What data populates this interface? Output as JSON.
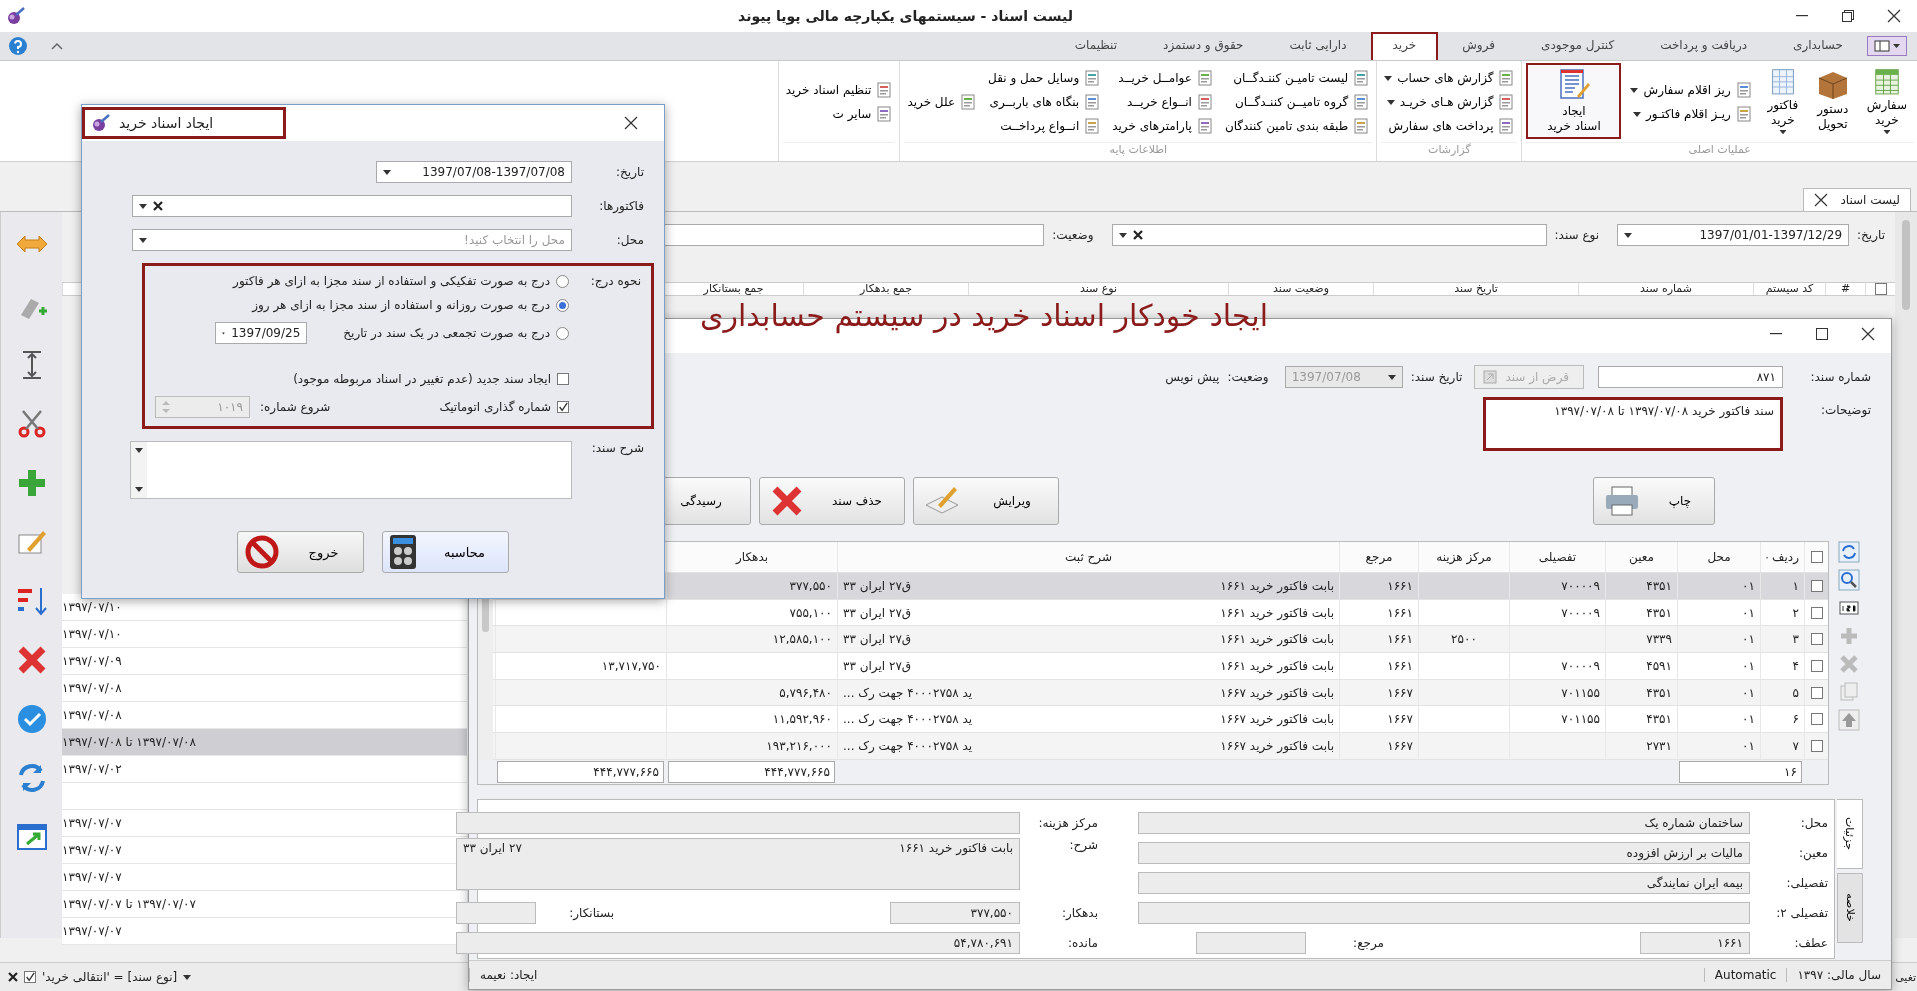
{
  "window": {
    "title": "لیست اسناد - سیستمهای یکپارچه مالی پویا پیوند"
  },
  "menu_tabs": [
    {
      "label": "حسابداری",
      "selected": false
    },
    {
      "label": "دریافت و پرداخت",
      "selected": false
    },
    {
      "label": "کنترل موجودی",
      "selected": false
    },
    {
      "label": "فروش",
      "selected": false
    },
    {
      "label": "خرید",
      "selected": true
    },
    {
      "label": "دارایی ثابت",
      "selected": false
    },
    {
      "label": "حقوق و دستمزد",
      "selected": false
    },
    {
      "label": "تنظیمات",
      "selected": false
    }
  ],
  "ribbon": [
    {
      "label": "عملیات اصلی",
      "items": [
        {
          "kind": "large",
          "lines": [
            "سفارش",
            "خرید"
          ],
          "dropdown": true,
          "highlighted": false
        },
        {
          "kind": "large",
          "lines": [
            "دستور",
            "تحویل"
          ],
          "dropdown": false,
          "highlighted": false
        },
        {
          "kind": "large",
          "lines": [
            "فاکتور",
            "خرید"
          ],
          "dropdown": true,
          "highlighted": false
        },
        {
          "kind": "small",
          "label": "ریز اقلام سفارش",
          "dropdown": true
        },
        {
          "kind": "small",
          "label": "ریـز اقلام فاکتـور",
          "dropdown": true
        },
        {
          "kind": "large",
          "lines": [
            "ایجاد",
            "اسناد خرید"
          ],
          "dropdown": false,
          "highlighted": true
        }
      ]
    },
    {
      "label": "گزارشات",
      "items": [
        {
          "kind": "small",
          "label": "گزارش های حساب",
          "dropdown": true
        },
        {
          "kind": "small",
          "label": "گزارش هـای خریـد",
          "dropdown": true
        },
        {
          "kind": "small",
          "label": "پرداخت های سفارش",
          "dropdown": false
        }
      ]
    },
    {
      "label": "اطلاعات پایه",
      "items": [
        {
          "kind": "small",
          "label": "لیست تامیـن کننـدگــان",
          "dropdown": false
        },
        {
          "kind": "small",
          "label": "گروه تامیــن کننـدگــان",
          "dropdown": false
        },
        {
          "kind": "small",
          "label": "طبقه بندی تامین کنندگان",
          "dropdown": false
        },
        {
          "kind": "small",
          "label": "عوامــل خریــد",
          "dropdown": false
        },
        {
          "kind": "small",
          "label": "انــواع خریــد",
          "dropdown": false
        },
        {
          "kind": "small",
          "label": "پارامترهای خرید",
          "dropdown": false
        },
        {
          "kind": "small",
          "label": "وسایل حمل و نقل",
          "dropdown": false
        },
        {
          "kind": "small",
          "label": "بنگاه های باربــری",
          "dropdown": false
        },
        {
          "kind": "small",
          "label": "انــواع پرداخــت",
          "dropdown": false
        },
        {
          "kind": "small",
          "label": "علل خرید",
          "dropdown": false
        }
      ]
    },
    {
      "items": [
        {
          "kind": "small",
          "label": "تنظیم اسناد خرید",
          "dropdown": false
        },
        {
          "kind": "small",
          "label": "سایر ت",
          "dropdown": false
        }
      ]
    }
  ],
  "doc_tab": {
    "label": "لیست اسناد"
  },
  "filters": [
    {
      "label": "تاریخ:",
      "value": "1397/01/01-1397/12/29"
    },
    {
      "label": "نوع سند:"
    },
    {
      "label": "وضعیت:"
    }
  ],
  "grid_select_all": {
    "checked": false
  },
  "grid_columns": [
    "#",
    "کد سیستم",
    "شماره سند",
    "تاریخ سند",
    "وضعیت سند",
    "نوع سند",
    "جمع بدهکار",
    "جمع بستانکار"
  ],
  "doc_list": [
    {
      "text": "۱۳۹۷/۰۷/۱۰",
      "selected": false
    },
    {
      "text": "۱۳۹۷/۰۷/۱۰",
      "selected": false
    },
    {
      "text": "۱۳۹۷/۰۷/۰۹",
      "selected": false
    },
    {
      "text": "۱۳۹۷/۰۷/۰۸",
      "selected": false
    },
    {
      "text": "۱۳۹۷/۰۷/۰۸",
      "selected": false
    },
    {
      "text": "۱۳۹۷/۰۷/۰۸ تا ۱۳۹۷/۰۷/۰۸",
      "selected": true
    },
    {
      "text": "۱۳۹۷/۰۷/۰۲",
      "selected": false
    },
    {
      "selected": false
    },
    {
      "text": "۱۳۹۷/۰۷/۰۷",
      "selected": false
    },
    {
      "text": "۱۳۹۷/۰۷/۰۷",
      "selected": false
    },
    {
      "text": "۱۳۹۷/۰۷/۰۷",
      "selected": false
    },
    {
      "text": "۱۳۹۷/۰۷/۰۷ تا ۱۳۹۷/۰۷/۰۷",
      "selected": false
    },
    {
      "text": "۱۳۹۷/۰۷/۰۷",
      "selected": false
    }
  ],
  "filter_bar": {
    "checked": true,
    "text": "[نوع سند] = 'انتقالی خرید'"
  },
  "status_bar": {
    "text": "تغیی"
  },
  "dialog": {
    "title": "ایجاد اسناد خرید",
    "title_highlighted": true,
    "date_label": "تاریخ:",
    "date": "1397/07/08-1397/07/08",
    "invoices_label": "فاکتورها:",
    "location_label": "محل:",
    "location_placeholder": "محل را انتخاب کنید!",
    "options_highlighted": true,
    "mode_label": "نحوه درج:",
    "modes": [
      {
        "label": "درج به صورت تفکیکی و استفاده از سند مجزا به ازای هر فاکتور",
        "selected": false
      },
      {
        "label": "درج به صورت روزانه و استفاده از سند مجزا به ازای هر روز",
        "selected": true
      },
      {
        "label": "درج به صورت تجمعی در یک سند در تاریخ",
        "selected": false,
        "date": "1397/09/25"
      }
    ],
    "new_doc": {
      "label": "ایجاد سند جدید (عدم تغییر در اسناد مربوطه موجود)",
      "checked": false
    },
    "auto_number": {
      "label": "شماره گذاری اتوماتیک",
      "checked": true
    },
    "start_label": "شروع شماره:",
    "start_number": "۱۰۱۹",
    "start_disabled": true,
    "desc_label": "شرح سند:",
    "buttons": [
      {
        "kind": "calculate",
        "label": "محاسبه"
      },
      {
        "kind": "exit",
        "label": "خروج"
      }
    ]
  },
  "document_window": {
    "annotation": "ایجاد خودکار اسناد خرید در سیستم حسابداری",
    "doc_number_label": "شماره سند:",
    "doc_number": "۸۷۱",
    "borrow_button": {
      "label": "قرض از سند",
      "disabled": true
    },
    "doc_date_label": "تاریخ سند:",
    "doc_date": "1397/07/08",
    "doc_date_disabled": true,
    "status_label": "وضعیت:",
    "status": "پیش نویس",
    "notes_label": "توضیحات:",
    "notes": "سند فاکتور خرید ۱۳۹۷/۰۷/۰۸ تا ۱۳۹۷/۰۷/۰۸",
    "notes_highlighted": true,
    "buttons": [
      {
        "kind": "print",
        "label": "چاپ"
      },
      {
        "kind": "edit",
        "label": "ویرایش"
      },
      {
        "kind": "delete",
        "label": "حذف سند"
      },
      {
        "kind": "review",
        "label": "رسیدگی"
      }
    ],
    "select_all_checked": false,
    "columns": [
      "ردیف",
      "محل",
      "معین",
      "تفصیلی",
      "مرکز هزینه",
      "مرجع",
      "شرح ثبت",
      "بدهکار"
    ],
    "rows": [
      {
        "checked": false,
        "row": "۱",
        "location": "۰۱",
        "account": "۴۳۵۱",
        "detail": "۷۰۰۰۰۹",
        "reference": "۱۶۶۱",
        "description": "بابت فاکتور خرید ۱۶۶۱",
        "description_end": "ق۲۷ ایران ۳۳",
        "debit": "۳۷۷,۵۵۰",
        "selected": true
      },
      {
        "checked": false,
        "row": "۲",
        "location": "۰۱",
        "account": "۴۳۵۱",
        "detail": "۷۰۰۰۰۹",
        "reference": "۱۶۶۱",
        "description": "بابت فاکتور خرید ۱۶۶۱",
        "description_end": "ق۲۷ ایران ۳۳",
        "debit": "۷۵۵,۱۰۰",
        "selected": false
      },
      {
        "checked": false,
        "row": "۳",
        "location": "۰۱",
        "account": "۷۳۳۹",
        "cost_center": "۲۵۰۰",
        "reference": "۱۶۶۱",
        "description": "بابت فاکتور خرید ۱۶۶۱",
        "description_end": "ق۲۷ ایران ۳۳",
        "debit": "۱۲,۵۸۵,۱۰۰",
        "selected": false
      },
      {
        "checked": false,
        "row": "۴",
        "location": "۰۱",
        "account": "۴۵۹۱",
        "detail": "۷۰۰۰۰۹",
        "reference": "۱۶۶۱",
        "description": "بابت فاکتور خرید ۱۶۶۱",
        "description_end": "ق۲۷ ایران ۳۳",
        "credit": "۱۳,۷۱۷,۷۵۰",
        "selected": false
      },
      {
        "checked": false,
        "row": "۵",
        "location": "۰۱",
        "account": "۴۳۵۱",
        "detail": "۷۰۱۱۵۵",
        "reference": "۱۶۶۷",
        "description": "بابت فاکتور خرید ۱۶۶۷",
        "description_end": "ید ۴۰۰۰۲۷۵۸ جهت رک ...",
        "debit": "۵,۷۹۶,۴۸۰",
        "selected": false
      },
      {
        "checked": false,
        "row": "۶",
        "location": "۰۱",
        "account": "۴۳۵۱",
        "detail": "۷۰۱۱۵۵",
        "reference": "۱۶۶۷",
        "description": "بابت فاکتور خرید ۱۶۶۷",
        "description_end": "ید ۴۰۰۰۲۷۵۸ جهت رک ...",
        "debit": "۱۱,۵۹۲,۹۶۰",
        "selected": false
      },
      {
        "checked": false,
        "row": "۷",
        "location": "۰۱",
        "account": "۲۷۳۱",
        "reference": "۱۶۶۷",
        "description": "بابت فاکتور خرید ۱۶۶۷",
        "description_end": "ید ۴۰۰۰۲۷۵۸ جهت رک ...",
        "debit": "۱۹۳,۲۱۶,۰۰۰",
        "selected": false
      }
    ],
    "totals": {
      "count": "۱۶",
      "debit": "۴۴۴,۷۷۷,۶۶۵",
      "credit": "۴۴۴,۷۷۷,۶۶۵"
    },
    "detail_tabs": [
      {
        "label": "جزئیات",
        "selected": true
      },
      {
        "label": "خلاصه",
        "selected": false
      }
    ],
    "details": {
      "location": {
        "label": "محل:",
        "value": "ساختمان شماره یک"
      },
      "account": {
        "label": "معین:",
        "value": "مالیات بر ارزش افزوده"
      },
      "detail": {
        "label": "تفصیلی:",
        "value": "بیمه ایران نمایندگی"
      },
      "detail2": {
        "label": "تفصیلی ۲:"
      },
      "ref_no": {
        "label": "عطف:",
        "value": "۱۶۶۱"
      },
      "reference": {
        "label": "مرجع:"
      },
      "cost_center": {
        "label": "مرکز هزینه:"
      },
      "description": {
        "label": "شرح:",
        "value": "بابت فاکتور خرید ۱۶۶۱",
        "value_end": "۲۷ ایران ۳۳"
      },
      "debit": {
        "label": "بدهکار:",
        "value": "۳۷۷,۵۵۰"
      },
      "credit": {
        "label": "بستانکار:"
      },
      "balance": {
        "label": "مانده:",
        "value": "۵۴,۷۸۰,۶۹۱"
      }
    },
    "status_items": [
      "سال مالی: ۱۳۹۷",
      "Automatic",
      "ایجاد: نعیمه"
    ]
  }
}
